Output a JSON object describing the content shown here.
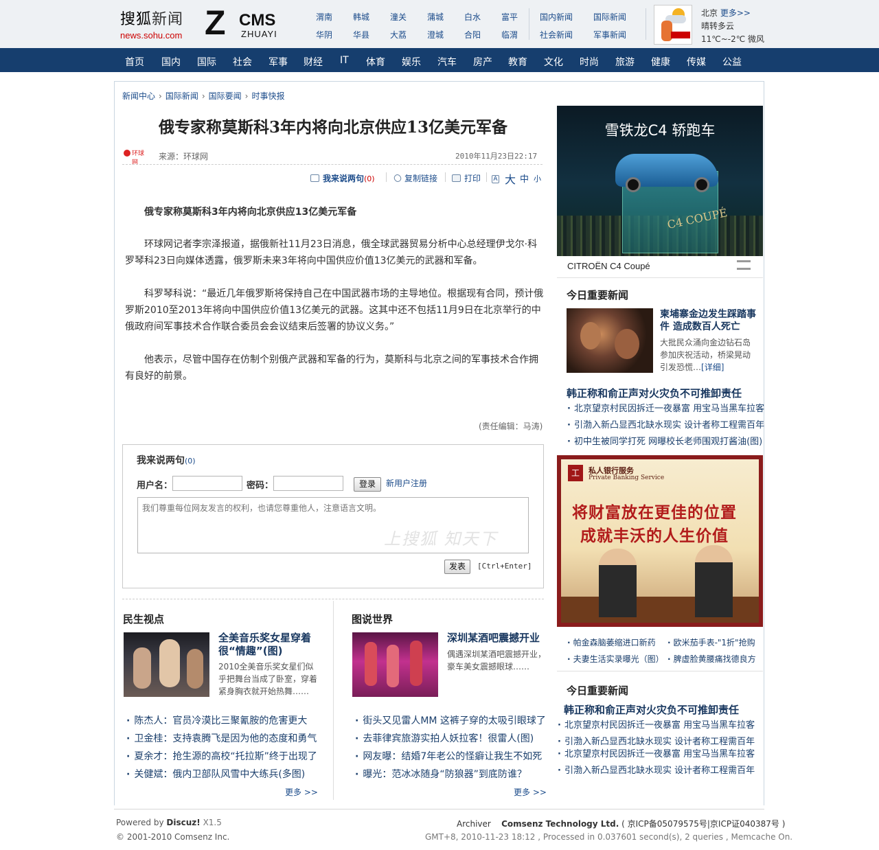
{
  "header": {
    "logo_main": "搜狐",
    "logo_news": "新闻",
    "logo_url": "news.sohu.com",
    "cms_z": "Z",
    "cms_text": "CMS",
    "cms_sub": "ZHUAYI",
    "cities_row1": [
      "渭南",
      "韩城",
      "潼关",
      "蒲城",
      "白水",
      "富平"
    ],
    "cities_row2": [
      "华阴",
      "华县",
      "大荔",
      "澄城",
      "合阳",
      "临渭"
    ],
    "news_links": [
      "国内新闻",
      "国际新闻",
      "社会新闻",
      "军事新闻"
    ],
    "weather": {
      "city": "北京",
      "more": "更多>>",
      "condition": "晴转多云",
      "temp": "11℃~-2℃ 微风"
    }
  },
  "nav": [
    "首页",
    "国内",
    "国际",
    "社会",
    "军事",
    "财经",
    "IT",
    "体育",
    "娱乐",
    "汽车",
    "房产",
    "教育",
    "文化",
    "时尚",
    "旅游",
    "健康",
    "传媒",
    "公益"
  ],
  "breadcrumb": [
    "新闻中心",
    "国际新闻",
    "国际要闻",
    "时事快报"
  ],
  "article": {
    "title": "俄专家称莫斯科3年内将向北京供应13亿美元军备",
    "source_logo": "环球网",
    "source": "来源：环球网",
    "time": "2010年11月23日22:17",
    "toolbar": {
      "comment": "我来说两句",
      "comment_count": "(0)",
      "copy_link": "复制链接",
      "print": "打印",
      "font_large": "大",
      "font_medium": "中",
      "font_small": "小"
    },
    "lead": "俄专家称莫斯科3年内将向北京供应13亿美元军备",
    "paragraphs": [
      "环球网记者李宗泽报道，据俄新社11月23日消息，俄全球武器贸易分析中心总经理伊戈尔·科罗琴科23日向媒体透露，俄罗斯未来3年将向中国供应价值13亿美元的武器和军备。",
      "科罗琴科说：“最近几年俄罗斯将保持自己在中国武器市场的主导地位。根据现有合同，预计俄罗斯2010至2013年将向中国供应价值13亿美元的武器。这其中还不包括11月9日在北京举行的中俄政府间军事技术合作联合委员会会议结束后签署的协议义务。”",
      "他表示，尽管中国存在仿制个别俄产武器和军备的行为，莫斯科与北京之间的军事技术合作拥有良好的前景。"
    ],
    "editor": "(责任编辑：马涛)"
  },
  "comment": {
    "title": "我来说两句",
    "count": "(0)",
    "username_label": "用户名：",
    "password_label": "密码：",
    "login_button": "登录",
    "register_link": "新用户注册",
    "placeholder": "我们尊重每位网友发言的权利，也请您尊重他人，注意语言文明。",
    "watermark": "上搜狐 知天下",
    "submit_button": "发表",
    "shortcut": "[Ctrl+Enter]"
  },
  "minsheng": {
    "title": "民生视点",
    "feature_title": "全美音乐奖女星穿着很“情趣”(图)",
    "feature_desc": "2010全美音乐奖女星们似乎把舞台当成了卧室，穿着紧身胸衣就开始热舞……",
    "list": [
      "陈杰人：官员冷漠比三聚氰胺的危害更大",
      "卫金桂：支持袁腾飞是因为他的态度和勇气",
      "夏余才：抢生源的高校“托拉斯”终于出现了",
      "关健斌：俄内卫部队风雪中大练兵(多图)"
    ],
    "more": "更多 >>"
  },
  "tushuo": {
    "title": "图说世界",
    "feature_title": "深圳某酒吧震撼开业",
    "feature_desc": "偶遇深圳某酒吧震撼开业，豪车美女震撼眼球……",
    "list": [
      "街头又见雷人MM 这裤子穿的太吸引眼球了",
      "去菲律宾旅游实拍人妖拉客！很雷人(图)",
      "网友曝：结婚7年老公的怪癖让我生不如死",
      "曝光：范冰冰随身“防狼器”到底防谁？"
    ],
    "more": "更多 >>"
  },
  "sidebar": {
    "ad_car_headline": "雪铁龙C4 轿跑车",
    "ad_car_model": "C4 COUPÉ",
    "ad_car_brand": "CITROËN C4 Coupé",
    "today_title": "今日重要新闻",
    "feature_title": "柬埔寨金边发生踩踏事件 造成数百人死亡",
    "feature_desc": "大批民众涌向金边钻石岛参加庆祝活动，桥梁晃动引发恐慌…",
    "feature_detail": "[详细]",
    "headline": "韩正称和俞正声对火灾负不可推卸责任",
    "list": [
      "北京望京村民因拆迁一夜暴富 用宝马当黑车拉客",
      "引渤入新凸显西北缺水现实 设计者称工程需百年",
      "初中生被同学打死 网曝校长老师围观打酱油(图)"
    ],
    "ad_bank_badge": "工",
    "ad_bank_title": "私人银行服务",
    "ad_bank_sub": "Private Banking Service",
    "ad_bank_slogan1": "将财富放在更佳的位置",
    "ad_bank_slogan2": "成就丰沃的人生价值",
    "ad_links": [
      "帕金森脑萎缩进口新药",
      "欧米茄手表-\"1折\"抢购",
      "夫妻生活实录曝光（图）",
      "脾虚脸黄腰痛找德良方"
    ],
    "today_title2": "今日重要新闻",
    "headline2": "韩正称和俞正声对火灾负不可推卸责任",
    "list2": [
      "北京望京村民因拆迁一夜暴富 用宝马当黑车拉客",
      "引渤入新凸显西北缺水现实 设计者称工程需百年",
      "北京望京村民因拆迁一夜暴富 用宝马当黑车拉客",
      "引渤入新凸显西北缺水现实 设计者称工程需百年"
    ]
  },
  "footer": {
    "powered_prefix": "Powered by",
    "powered_name": "Discuz!",
    "powered_version": "X1.5",
    "copyright": "© 2001-2010 Comsenz Inc.",
    "archiver": "Archiver",
    "company": "Comsenz Technology Ltd.",
    "icp": "( 京ICP备05079575号|京ICP证040387号 )",
    "stats": "GMT+8, 2010-11-23 18:12 , Processed in 0.037601 second(s), 2 queries , Memcache On."
  }
}
